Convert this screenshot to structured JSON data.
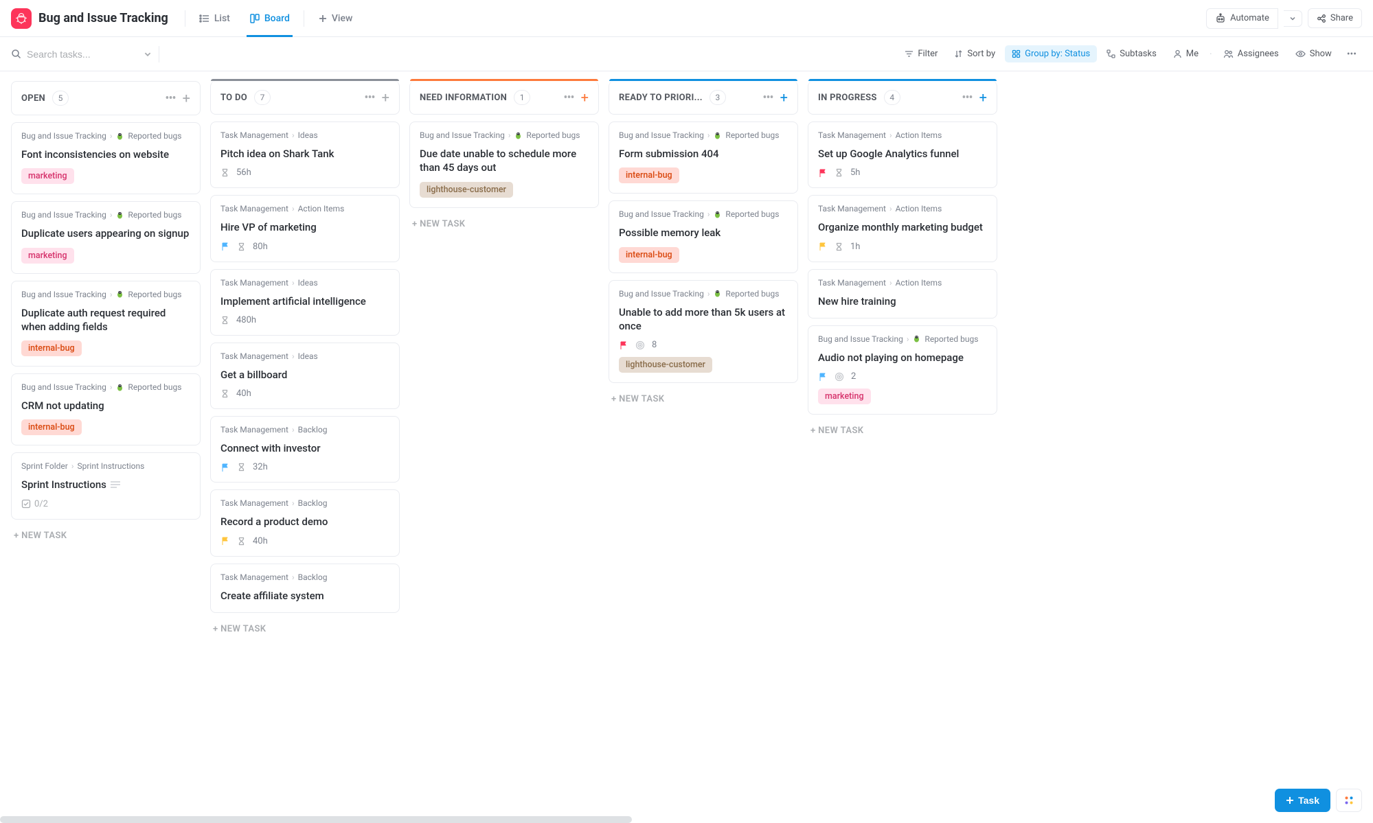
{
  "header": {
    "title": "Bug and Issue Tracking",
    "tabs": {
      "list": "List",
      "board": "Board",
      "addView": "View"
    },
    "automate": "Automate",
    "share": "Share"
  },
  "toolbar": {
    "searchPlaceholder": "Search tasks...",
    "filter": "Filter",
    "sort": "Sort by",
    "group": "Group by: Status",
    "subtasks": "Subtasks",
    "me": "Me",
    "assignees": "Assignees",
    "show": "Show"
  },
  "newTask": "+ NEW TASK",
  "taskButton": "Task",
  "crumbLabels": {
    "bugTracking": "Bug and Issue Tracking",
    "reportedBugs": "Reported bugs",
    "taskMgmt": "Task Management",
    "ideas": "Ideas",
    "actionItems": "Action Items",
    "backlog": "Backlog",
    "sprintFolder": "Sprint Folder",
    "sprintInstr": "Sprint Instructions"
  },
  "columns": [
    {
      "name": "OPEN",
      "count": "5",
      "bar": null,
      "addColor": "",
      "cards": [
        {
          "crumbType": "bug",
          "title": "Font inconsistencies on website",
          "tag": "marketing"
        },
        {
          "crumbType": "bug",
          "title": "Duplicate users appearing on signup",
          "tag": "marketing"
        },
        {
          "crumbType": "bug",
          "title": "Duplicate auth request required when adding fields",
          "tag": "internal-bug"
        },
        {
          "crumbType": "bug",
          "title": "CRM not updating",
          "tag": "internal-bug"
        },
        {
          "crumbType": "sprint",
          "title": "Sprint Instructions",
          "checklist": "0/2",
          "hasDesc": true
        }
      ]
    },
    {
      "name": "TO DO",
      "count": "7",
      "bar": "#8a8f98",
      "addColor": "",
      "cards": [
        {
          "crumbType": "ideas",
          "title": "Pitch idea on Shark Tank",
          "time": "56h"
        },
        {
          "crumbType": "action",
          "title": "Hire VP of marketing",
          "flag": "#4fb5ff",
          "time": "80h"
        },
        {
          "crumbType": "ideas",
          "title": "Implement artificial intelligence",
          "time": "480h"
        },
        {
          "crumbType": "ideas",
          "title": "Get a billboard",
          "time": "40h"
        },
        {
          "crumbType": "backlog",
          "title": "Connect with investor",
          "flag": "#4fb5ff",
          "time": "32h"
        },
        {
          "crumbType": "backlog",
          "title": "Record a product demo",
          "flag": "#ffc53d",
          "time": "40h"
        },
        {
          "crumbType": "backlog",
          "title": "Create affiliate system"
        }
      ]
    },
    {
      "name": "NEED INFORMATION",
      "count": "1",
      "bar": "#fd7a3c",
      "addColor": "orange",
      "cards": [
        {
          "crumbType": "bug",
          "title": "Due date unable to schedule more than 45 days out",
          "tag": "lighthouse-customer"
        }
      ]
    },
    {
      "name": "READY TO PRIORI...",
      "count": "3",
      "bar": "#1090e0",
      "addColor": "blue",
      "cards": [
        {
          "crumbType": "bug",
          "title": "Form submission 404",
          "tag": "internal-bug"
        },
        {
          "crumbType": "bug",
          "title": "Possible memory leak",
          "tag": "internal-bug"
        },
        {
          "crumbType": "bug",
          "title": "Unable to add more than 5k users at once",
          "flag": "#fd355a",
          "sprint": "8",
          "tag": "lighthouse-customer"
        }
      ]
    },
    {
      "name": "IN PROGRESS",
      "count": "4",
      "bar": "#1090e0",
      "addColor": "blue",
      "cards": [
        {
          "crumbType": "action",
          "title": "Set up Google Analytics funnel",
          "flag": "#fd355a",
          "time": "5h"
        },
        {
          "crumbType": "action",
          "title": "Organize monthly marketing budget",
          "flag": "#ffc53d",
          "time": "1h"
        },
        {
          "crumbType": "action",
          "title": "New hire training"
        },
        {
          "crumbType": "bug",
          "title": "Audio not playing on homepage",
          "flag": "#4fb5ff",
          "sprint": "2",
          "tag": "marketing"
        }
      ]
    }
  ]
}
